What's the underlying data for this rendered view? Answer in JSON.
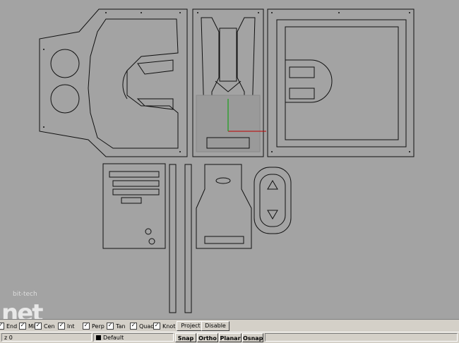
{
  "osnap": {
    "items": [
      {
        "label": "End",
        "checked": true
      },
      {
        "label": "Mid",
        "checked": true
      },
      {
        "label": "Cen",
        "checked": true
      },
      {
        "label": "Int",
        "checked": true
      },
      {
        "label": "Perp",
        "checked": true
      },
      {
        "label": "Tan",
        "checked": true
      },
      {
        "label": "Quad",
        "checked": true
      },
      {
        "label": "Knot",
        "checked": true
      }
    ],
    "project_label": "Project",
    "disable_label": "Disable"
  },
  "status": {
    "coord": "z 0",
    "layer": "Default",
    "snap": "Snap",
    "ortho": "Ortho",
    "planar": "Planar",
    "osnap": "Osnap"
  },
  "watermark": {
    "text": "bit-tech",
    "logo": "net"
  },
  "colors": {
    "viewport_bg": "#a3a3a3",
    "line": "#101010",
    "grid": "#8a8a8a",
    "x_axis": "#c00000",
    "y_axis": "#00a000",
    "chrome": "#d4d0c8"
  }
}
